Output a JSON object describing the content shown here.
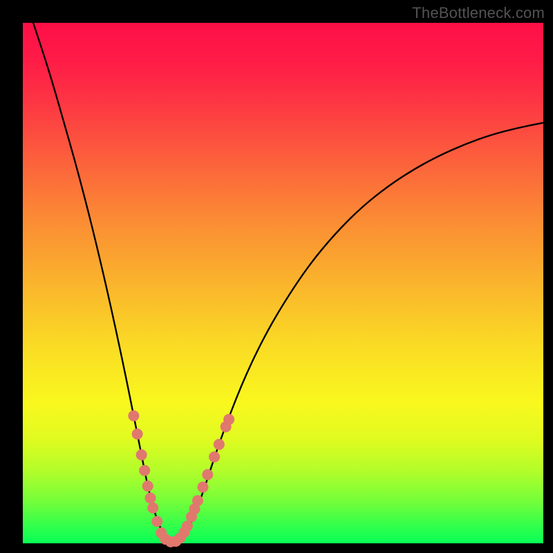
{
  "watermark": "TheBottleneck.com",
  "chart_data": {
    "type": "line",
    "title": "",
    "xlabel": "",
    "ylabel": "",
    "xlim": [
      0,
      100
    ],
    "ylim": [
      0,
      100
    ],
    "grid": false,
    "series": [
      {
        "name": "bottleneck-curve",
        "color": "#000000",
        "x": [
          2,
          4,
          6,
          8,
          10,
          12,
          14,
          16,
          18,
          20,
          22,
          23,
          24,
          25,
          26,
          27,
          28,
          29,
          30,
          32,
          34,
          36,
          38,
          42,
          46,
          50,
          55,
          60,
          65,
          70,
          75,
          80,
          85,
          90,
          95,
          100
        ],
        "y": [
          100,
          94,
          87.5,
          80.5,
          73.5,
          66,
          58,
          49.5,
          40.5,
          31,
          21,
          16,
          11,
          7,
          4,
          1.7,
          0.5,
          0.2,
          0.4,
          3,
          8,
          14,
          20,
          30.5,
          39,
          46,
          53.5,
          59.5,
          64.5,
          68.5,
          71.8,
          74.5,
          76.7,
          78.5,
          79.8,
          80.8
        ]
      }
    ],
    "markers": [
      {
        "name": "left-21",
        "x": 21.3,
        "y": 24.5
      },
      {
        "name": "left-22",
        "x": 22.0,
        "y": 21.0
      },
      {
        "name": "left-23a",
        "x": 22.8,
        "y": 17.0
      },
      {
        "name": "left-23b",
        "x": 23.4,
        "y": 14.0
      },
      {
        "name": "left-24",
        "x": 24.0,
        "y": 11.0
      },
      {
        "name": "left-25a",
        "x": 24.5,
        "y": 8.7
      },
      {
        "name": "left-25b",
        "x": 25.0,
        "y": 6.8
      },
      {
        "name": "left-26",
        "x": 25.8,
        "y": 4.2
      },
      {
        "name": "left-27",
        "x": 26.6,
        "y": 2.0
      },
      {
        "name": "bottom-28",
        "x": 27.4,
        "y": 0.8
      },
      {
        "name": "bottom-29",
        "x": 28.4,
        "y": 0.3
      },
      {
        "name": "bottom-30",
        "x": 29.4,
        "y": 0.4
      },
      {
        "name": "bottom-31",
        "x": 30.2,
        "y": 1.0
      },
      {
        "name": "right-31",
        "x": 31.0,
        "y": 2.1
      },
      {
        "name": "right-32",
        "x": 31.6,
        "y": 3.3
      },
      {
        "name": "right-33a",
        "x": 32.4,
        "y": 5.1
      },
      {
        "name": "right-33b",
        "x": 33.0,
        "y": 6.6
      },
      {
        "name": "right-34",
        "x": 33.6,
        "y": 8.2
      },
      {
        "name": "right-35",
        "x": 34.6,
        "y": 10.8
      },
      {
        "name": "right-36a",
        "x": 35.5,
        "y": 13.2
      },
      {
        "name": "right-37",
        "x": 36.8,
        "y": 16.6
      },
      {
        "name": "right-38",
        "x": 37.7,
        "y": 19.0
      },
      {
        "name": "right-39a",
        "x": 39.0,
        "y": 22.4
      },
      {
        "name": "right-39b",
        "x": 39.6,
        "y": 23.8
      }
    ],
    "marker_style": {
      "color": "#e0786e",
      "radius_px": 8
    }
  }
}
